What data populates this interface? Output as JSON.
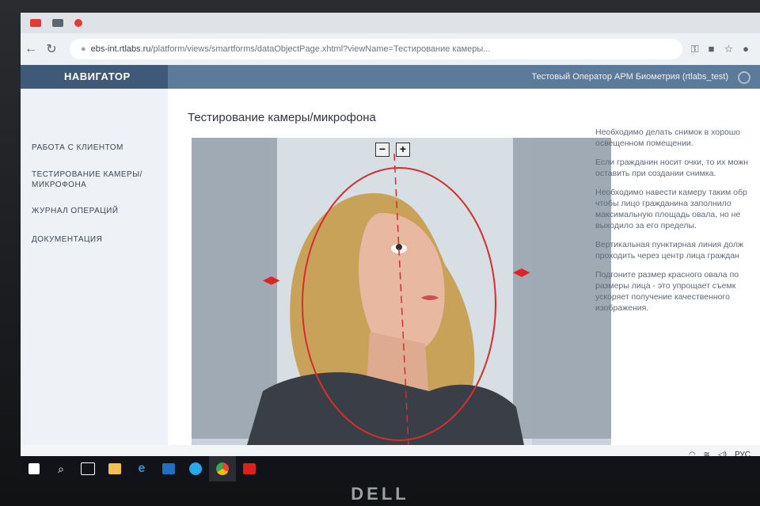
{
  "browser": {
    "url_host": "ebs-int.rtlabs.ru",
    "url_path": "/platform/views/smartforms/dataObjectPage.xhtml?viewName=Тестирование камеры..."
  },
  "header": {
    "nav_title": "НАВИГАТОР",
    "operator": "Тестовый Оператор АРМ Биометрия (rtlabs_test)"
  },
  "sidebar": {
    "items": [
      {
        "label": "РАБОТА С КЛИЕНТОМ"
      },
      {
        "label": "ТЕСТИРОВАНИЕ КАМЕРЫ/ МИКРОФОНА"
      },
      {
        "label": "ЖУРНАЛ ОПЕРАЦИЙ"
      },
      {
        "label": "ДОКУМЕНТАЦИЯ"
      }
    ]
  },
  "main": {
    "title": "Тестирование камеры/микрофона",
    "zoom_minus": "−",
    "zoom_plus": "+"
  },
  "instructions": [
    "Необходимо делать снимок в хорошо освещенном помещении.",
    "Если гражданин носит очки, то их можн оставить при создании снимка.",
    "Необходимо навести камеру таким обр чтобы лицо гражданина заполнило максимальную площадь овала, но не выходило за его пределы.",
    "Вертикальная пунктирная линия долж проходить через центр лица граждан",
    "Подгоните размер красного овала по размеры лица - это упрощает съемк ускоряет получение качественного изображения."
  ],
  "tray": {
    "language": "РУС"
  },
  "taskbar_icons": [
    "windows-start-icon",
    "search-icon",
    "task-view-icon",
    "file-explorer-icon",
    "edge-icon",
    "outlook-icon",
    "skype-icon",
    "chrome-icon",
    "acrobat-icon"
  ],
  "monitor_brand": "DELL",
  "colors": {
    "nav_bg": "#3f5a78",
    "header_bg": "#5c7a9a",
    "oval": "#d32f2f"
  }
}
